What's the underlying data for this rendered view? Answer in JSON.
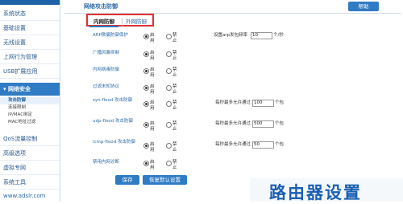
{
  "sidebar": {
    "items": [
      {
        "label": "系统状态"
      },
      {
        "label": "基础设置"
      },
      {
        "label": "无线设置"
      },
      {
        "label": "上网行为管理"
      },
      {
        "label": "USB扩展应用"
      },
      {
        "label": "网络安全"
      },
      {
        "label": "QoS流量控制"
      },
      {
        "label": "高级选项"
      },
      {
        "label": "虚拟专网"
      },
      {
        "label": "系统工具"
      }
    ],
    "subitems": [
      {
        "label": "攻击防御"
      },
      {
        "label": "连接限制"
      },
      {
        "label": "IP/MAC绑定"
      },
      {
        "label": "MAC地址过滤"
      }
    ],
    "footer_url": "www.adslr.com"
  },
  "header": {
    "title": "网络攻击防御",
    "help_label": "帮助"
  },
  "tabs": [
    {
      "label": "内网防御"
    },
    {
      "label": "外网防御"
    }
  ],
  "options": {
    "enable": "启用",
    "disable": "禁止"
  },
  "rows": [
    {
      "label": "ARP欺骗防御保护",
      "state": "enable",
      "extra_prefix": "设置arp发包频率",
      "value": "10",
      "extra_suffix": "个/秒"
    },
    {
      "label": "广播风暴抑制",
      "state": "enable"
    },
    {
      "label": "内网病毒防御",
      "state": "enable"
    },
    {
      "label": "过滤未知协议",
      "state": "enable"
    },
    {
      "label": "syn-flood 攻击防御",
      "state": "enable",
      "extra_prefix": "每秒最多允许通过",
      "value": "100",
      "extra_suffix": "个包"
    },
    {
      "label": "udp-flood 攻击防御",
      "state": "enable",
      "extra_prefix": "每秒最多允许通过",
      "value": "500",
      "extra_suffix": "个包"
    },
    {
      "label": "icmp-flood 攻击防御",
      "state": "enable",
      "extra_prefix": "每秒最多允许通过",
      "value": "50",
      "extra_suffix": "个包"
    },
    {
      "label": "禁用内网诊断",
      "state": "enable"
    }
  ],
  "buttons": {
    "save": "保存",
    "restore": "恢复默认设置"
  },
  "watermark": "路由器设置",
  "colors": {
    "accent": "#2f7bc4",
    "highlight": "#e03030"
  }
}
